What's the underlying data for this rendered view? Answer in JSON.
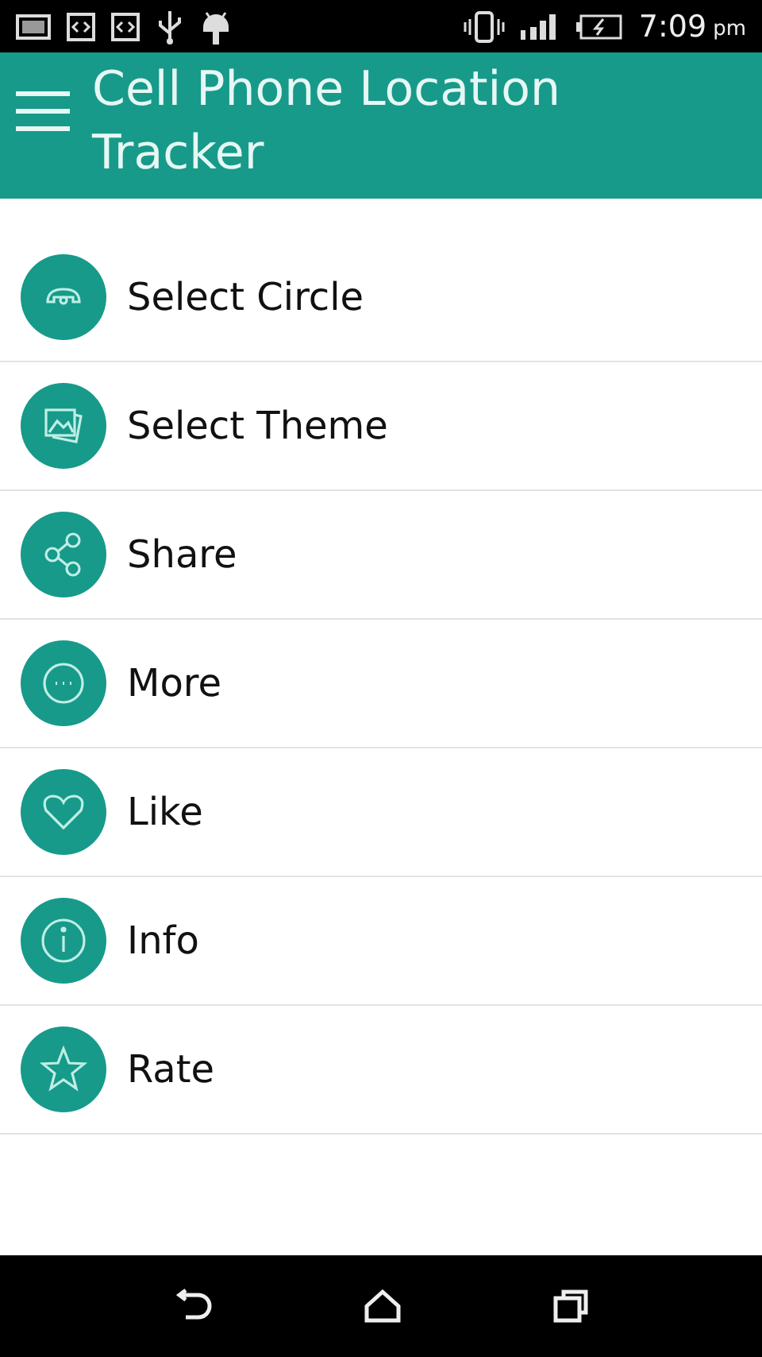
{
  "status_bar": {
    "time": "7:09",
    "period": "pm"
  },
  "app_bar": {
    "title": "Cell Phone Location Tracker"
  },
  "menu": [
    {
      "kind": "circle",
      "label": "Select Circle"
    },
    {
      "kind": "theme",
      "label": "Select Theme"
    },
    {
      "kind": "share",
      "label": "Share"
    },
    {
      "kind": "more",
      "label": "More"
    },
    {
      "kind": "like",
      "label": "Like"
    },
    {
      "kind": "info",
      "label": "Info"
    },
    {
      "kind": "rate",
      "label": "Rate"
    }
  ]
}
